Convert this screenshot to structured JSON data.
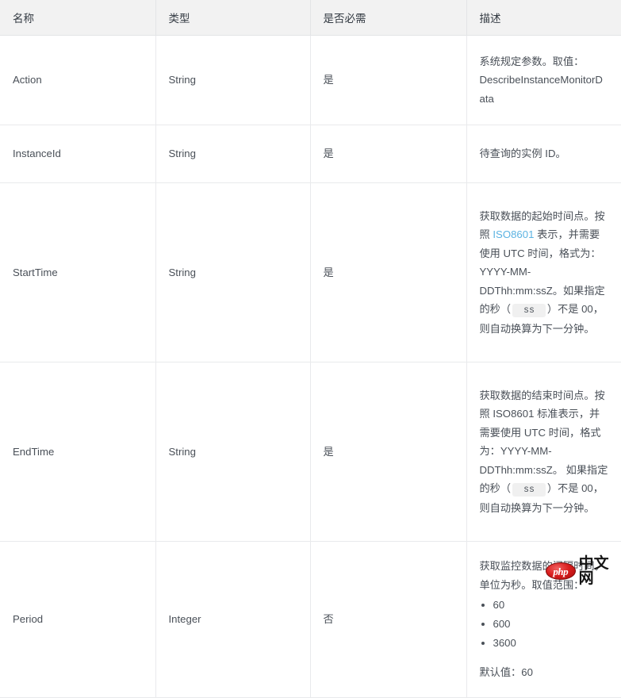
{
  "table": {
    "headers": [
      "名称",
      "类型",
      "是否必需",
      "描述"
    ],
    "rows": [
      {
        "name": "Action",
        "type": "String",
        "required": "是",
        "desc_parts": {
          "p1": "系统规定参数。取值：DescribeInstanceMonitorData"
        }
      },
      {
        "name": "InstanceId",
        "type": "String",
        "required": "是",
        "desc_parts": {
          "p1": "待查询的实例 ID。"
        }
      },
      {
        "name": "StartTime",
        "type": "String",
        "required": "是",
        "desc_parts": {
          "seg1": "获取数据的起始时间点。按照 ",
          "link": "ISO8601",
          "seg2": " 表示，并需要使用 UTC 时间，格式为：YYYY-MM-DDThh:mm:ssZ。如果指定的秒（",
          "code": "ss",
          "seg3": "）不是 00，则自动换算为下一分钟。"
        }
      },
      {
        "name": "EndTime",
        "type": "String",
        "required": "是",
        "desc_parts": {
          "seg1": "获取数据的结束时间点。按照 ISO8601 标准表示，并需要使用 UTC 时间，格式为：YYYY-MM-DDThh:mm:ssZ。 如果指定的秒（",
          "code": "ss",
          "seg3": "）不是 00，则自动换算为下一分钟。"
        }
      },
      {
        "name": "Period",
        "type": "Integer",
        "required": "否",
        "desc_parts": {
          "intro": "获取监控数据的间隔时间，单位为秒。取值范围：",
          "options": [
            "60",
            "600",
            "3600"
          ],
          "default": "默认值：60"
        }
      }
    ]
  },
  "watermark": {
    "badge": "php",
    "text": "中文网",
    "badge_color": "#d91c1c"
  }
}
